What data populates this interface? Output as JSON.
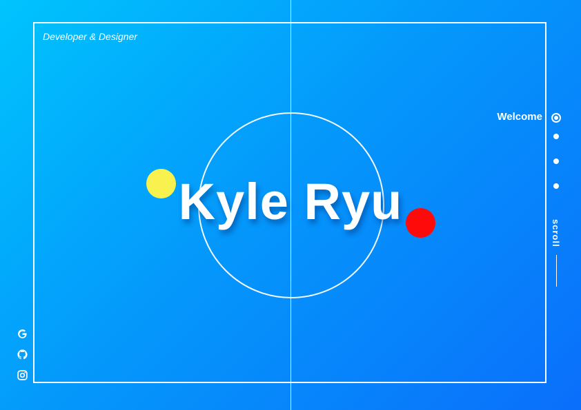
{
  "hero": {
    "tagline": "Developer & Designer",
    "name": "Kyle Ryu"
  },
  "decor": {
    "accent_yellow": "#f9f24e",
    "accent_red": "#ff0a0a",
    "gradient_start": "#00c4fd",
    "gradient_end": "#0a6ffb"
  },
  "section_nav": {
    "active_label": "Welcome",
    "dots": [
      {
        "label": "Welcome",
        "active": true
      },
      {
        "label": "",
        "active": false
      },
      {
        "label": "",
        "active": false
      },
      {
        "label": "",
        "active": false
      }
    ]
  },
  "scroll_indicator": {
    "label": "scroll"
  },
  "social_links": [
    {
      "icon": "google-icon"
    },
    {
      "icon": "github-icon"
    },
    {
      "icon": "instagram-icon"
    }
  ]
}
